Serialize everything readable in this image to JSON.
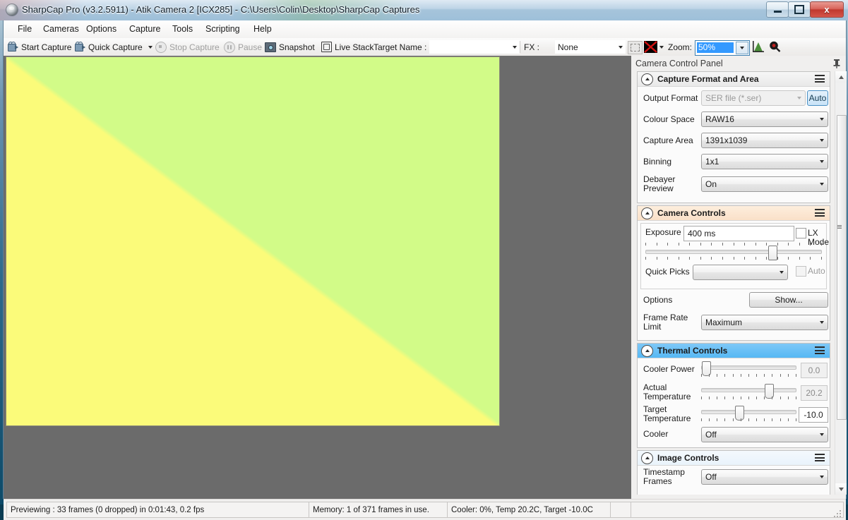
{
  "window": {
    "title": "SharpCap Pro (v3.2.5911) - Atik Camera 2 [ICX285] - C:\\Users\\Colin\\Desktop\\SharpCap Captures",
    "minimize_label": "Minimize",
    "maximize_label": "Maximize",
    "close_label": "x"
  },
  "menu": {
    "items": [
      {
        "label": "File"
      },
      {
        "label": "Cameras"
      },
      {
        "label": "Options"
      },
      {
        "label": "Capture"
      },
      {
        "label": "Tools"
      },
      {
        "label": "Scripting"
      },
      {
        "label": "Help"
      }
    ]
  },
  "toolbar": {
    "start_capture": "Start Capture",
    "quick_capture": "Quick Capture",
    "stop_capture": "Stop Capture",
    "pause": "Pause",
    "snapshot": "Snapshot",
    "live_stack": "Live Stack",
    "target_name_label": "Target Name :",
    "target_name_value": "",
    "fx_label": "FX :",
    "fx_value": "None",
    "zoom_label": "Zoom:",
    "zoom_value": "50%",
    "selection_color": "#3399ff"
  },
  "dock": {
    "title": "Camera Control Panel",
    "pin_icon": "pin-icon"
  },
  "capture_format": {
    "header": "Capture Format and Area",
    "output_format_label": "Output Format",
    "output_format_value": "SER file (*.ser)",
    "auto_button": "Auto",
    "colour_space_label": "Colour Space",
    "colour_space_value": "RAW16",
    "capture_area_label": "Capture Area",
    "capture_area_value": "1391x1039",
    "binning_label": "Binning",
    "binning_value": "1x1",
    "debayer_label": "Debayer Preview",
    "debayer_value": "On"
  },
  "camera_controls": {
    "header": "Camera Controls",
    "exposure_label": "Exposure",
    "exposure_value": "400 ms",
    "lx_mode_label": "LX Mode",
    "lx_mode_checked": false,
    "quick_picks_label": "Quick Picks",
    "quick_picks_value": "",
    "auto_label": "Auto",
    "auto_checked": false,
    "options_label": "Options",
    "show_button": "Show...",
    "frame_rate_label": "Frame Rate Limit",
    "frame_rate_value": "Maximum",
    "exposure_slider_pct": 74
  },
  "thermal_controls": {
    "header": "Thermal Controls",
    "cooler_power_label": "Cooler Power",
    "cooler_power_value": "0.0",
    "cooler_power_pct": 2,
    "actual_temp_label": "Actual Temperature",
    "actual_temp_value": "20.2",
    "actual_temp_pct": 69,
    "target_temp_label": "Target Temperature",
    "target_temp_value": "-10.0",
    "target_temp_pct": 39,
    "cooler_label": "Cooler",
    "cooler_value": "Off",
    "header_color": "#56b8f4"
  },
  "image_controls": {
    "header": "Image Controls",
    "timestamp_label": "Timestamp Frames",
    "timestamp_value": "Off"
  },
  "status_bar": {
    "preview": "Previewing : 33 frames (0 dropped) in 0:01:43, 0.2 fps",
    "memory": "Memory: 1 of 371 frames in use.",
    "cooler": "Cooler: 0%, Temp 20.2C, Target -10.0C",
    "extra": ""
  },
  "preview_image": {
    "yellow": "#FBFB7A",
    "green": "#D2FB88",
    "background": "#6B6B6B",
    "border": "#8B8B78"
  }
}
